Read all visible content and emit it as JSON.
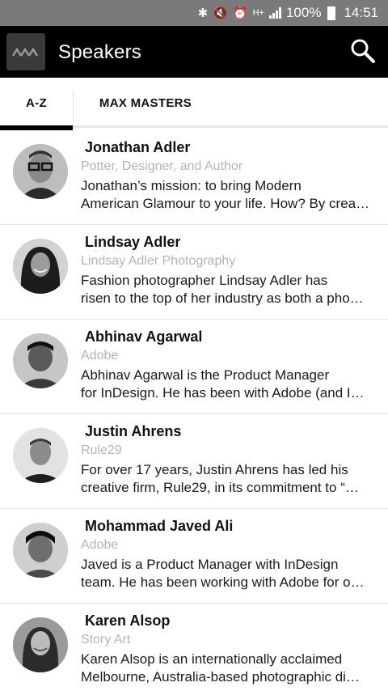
{
  "status_bar": {
    "battery": "100%",
    "time": "14:51",
    "network": "H+"
  },
  "app_bar": {
    "title": "Speakers",
    "logo_text": "MAX"
  },
  "tabs": [
    {
      "label": "A-Z",
      "selected": true
    },
    {
      "label": "MAX MASTERS",
      "selected": false
    }
  ],
  "speakers": [
    {
      "name": "Jonathan Adler",
      "org": "Potter, Designer, and Author",
      "bio_line1": "Jonathan’s mission: to bring Modern",
      "bio_line2": "American Glamour to your life. How? By crea…"
    },
    {
      "name": "Lindsay Adler",
      "org": "Lindsay Adler Photography",
      "bio_line1": "Fashion photographer Lindsay Adler has",
      "bio_line2": "risen to the top of her industry as both a pho…"
    },
    {
      "name": "Abhinav Agarwal",
      "org": "Adobe",
      "bio_line1": "Abhinav Agarwal is the Product Manager",
      "bio_line2": "for InDesign. He has been with Adobe (and I…"
    },
    {
      "name": "Justin Ahrens",
      "org": "Rule29",
      "bio_line1": "For over 17 years, Justin Ahrens has led his",
      "bio_line2": "creative firm, Rule29, in its commitment to “…"
    },
    {
      "name": "Mohammad Javed Ali",
      "org": "Adobe",
      "bio_line1": "Javed is a Product Manager with InDesign",
      "bio_line2": "team. He has been working with Adobe for o…"
    },
    {
      "name": "Karen Alsop",
      "org": "Story Art",
      "bio_line1": "Karen Alsop is an internationally acclaimed",
      "bio_line2": "Melbourne, Australia-based photographic di…"
    }
  ]
}
